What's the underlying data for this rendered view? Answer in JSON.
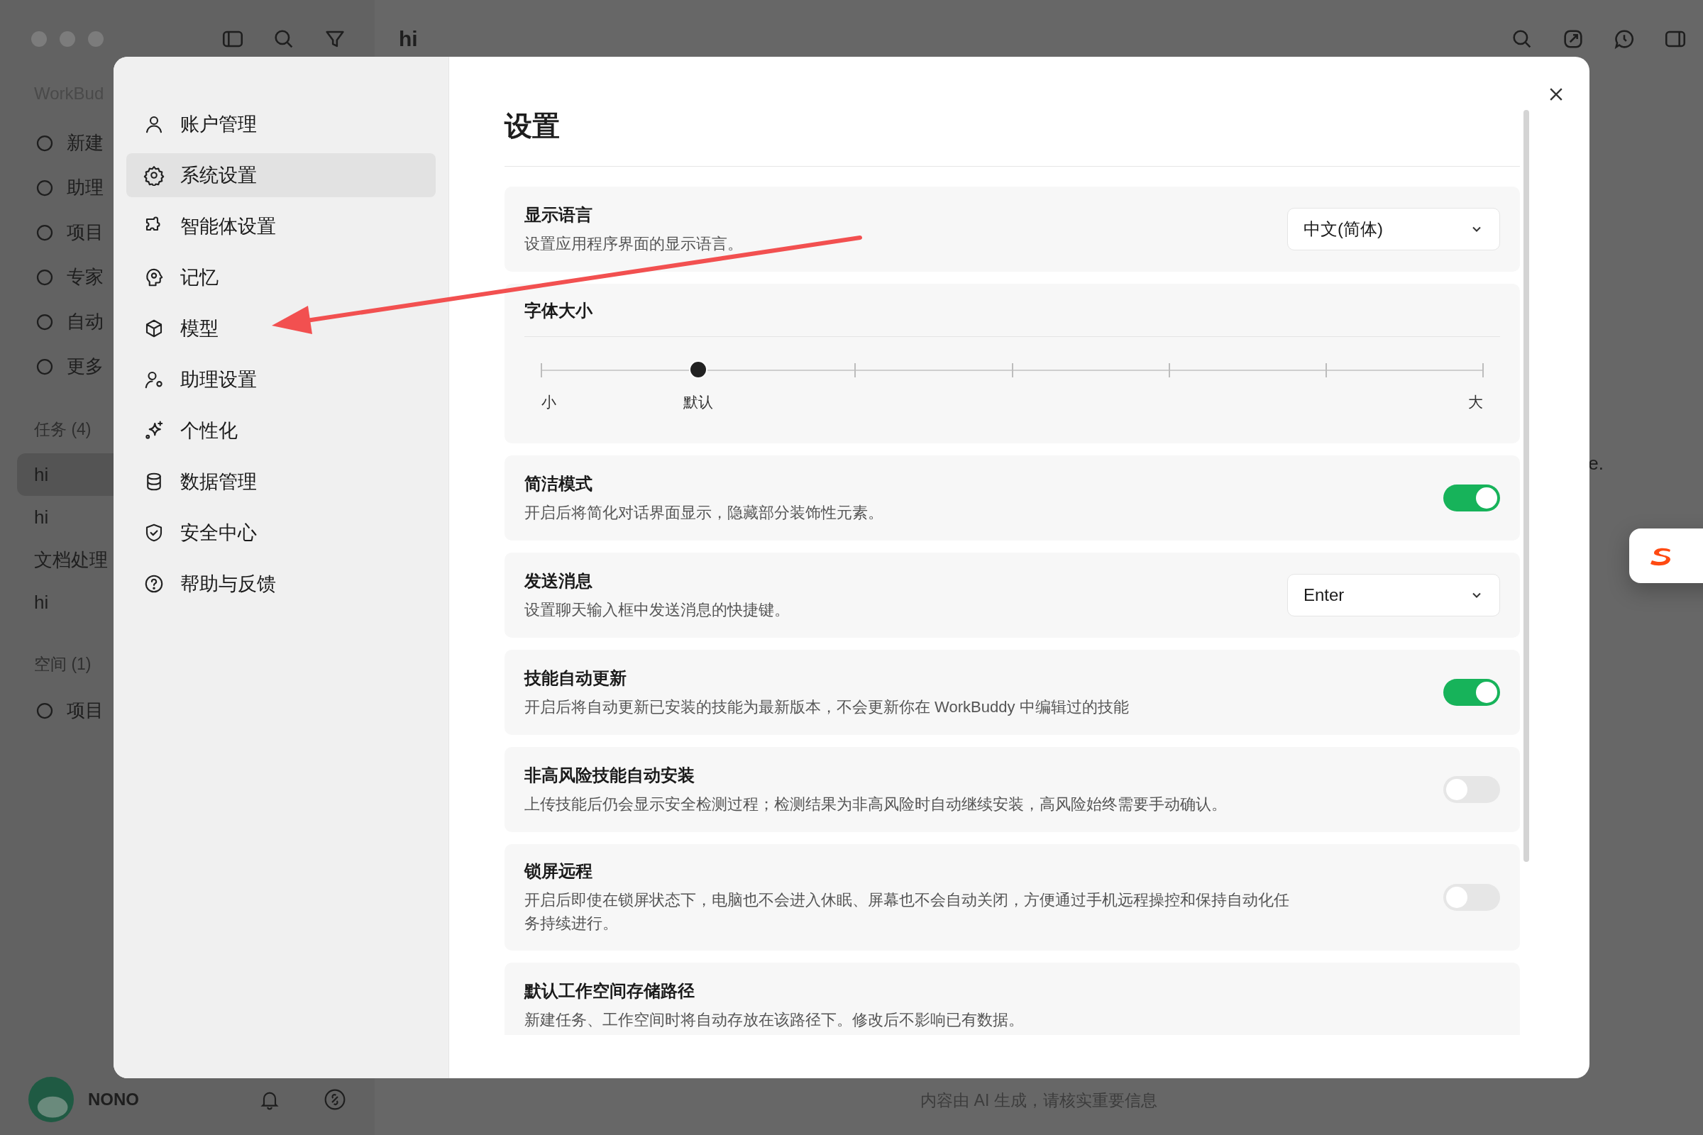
{
  "background_app": {
    "brand": "WorkBud",
    "title": "hi",
    "nav": [
      {
        "label": "新建"
      },
      {
        "label": "助理"
      },
      {
        "label": "项目"
      },
      {
        "label": "专家"
      },
      {
        "label": "自动"
      },
      {
        "label": "更多"
      }
    ],
    "tasks_header": "任务 (4)",
    "tasks": [
      {
        "label": "hi",
        "selected": true
      },
      {
        "label": "hi",
        "selected": false
      },
      {
        "label": "文档处理",
        "selected": false
      },
      {
        "label": "hi",
        "selected": false
      }
    ],
    "spaces_header": "空间 (1)",
    "spaces": [
      {
        "label": "项目"
      }
    ],
    "user": "NONO",
    "fragment": "e.",
    "footer": "内容由 AI 生成，请核实重要信息"
  },
  "settings_dialog": {
    "title": "设置",
    "menu": [
      {
        "label": "账户管理",
        "selected": false
      },
      {
        "label": "系统设置",
        "selected": true
      },
      {
        "label": "智能体设置",
        "selected": false
      },
      {
        "label": "记忆",
        "selected": false
      },
      {
        "label": "模型",
        "selected": false
      },
      {
        "label": "助理设置",
        "selected": false
      },
      {
        "label": "个性化",
        "selected": false
      },
      {
        "label": "数据管理",
        "selected": false
      },
      {
        "label": "安全中心",
        "selected": false
      },
      {
        "label": "帮助与反馈",
        "selected": false
      }
    ],
    "sections": [
      {
        "kind": "select",
        "title": "显示语言",
        "description": "设置应用程序界面的显示语言。",
        "value": "中文(简体)"
      },
      {
        "kind": "slider",
        "title": "字体大小",
        "level": 0.1667,
        "labels": [
          "小",
          "默认",
          "大"
        ]
      },
      {
        "kind": "toggle",
        "title": "简洁模式",
        "description": "开启后将简化对话界面显示，隐藏部分装饰性元素。",
        "on": true
      },
      {
        "kind": "select",
        "title": "发送消息",
        "description": "设置聊天输入框中发送消息的快捷键。",
        "value": "Enter"
      },
      {
        "kind": "toggle",
        "title": "技能自动更新",
        "description": "开启后将自动更新已安装的技能为最新版本，不会更新你在 WorkBuddy 中编辑过的技能",
        "on": true
      },
      {
        "kind": "toggle",
        "title": "非高风险技能自动安装",
        "description": "上传技能后仍会显示安全检测过程；检测结果为非高风险时自动继续安装，高风险始终需要手动确认。",
        "on": false
      },
      {
        "kind": "toggle",
        "title": "锁屏远程",
        "description": "开启后即使在锁屏状态下，电脑也不会进入休眠、屏幕也不会自动关闭，方便通过手机远程操控和保持自动化任务持续进行。",
        "on": false
      },
      {
        "kind": "text",
        "title": "默认工作空间存储路径",
        "description": "新建任务、工作空间时将自动存放在该路径下。修改后不影响已有数据。"
      }
    ]
  }
}
